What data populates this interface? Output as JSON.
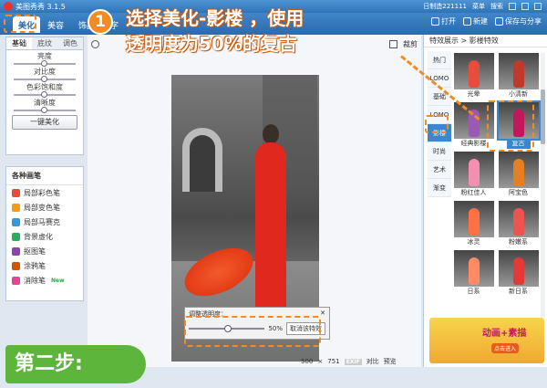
{
  "app": {
    "title": "美图秀秀 3.1.5",
    "username": "日制造221111",
    "menu_buy": "菜单",
    "menu_min": "搜索"
  },
  "menu": {
    "tabs": [
      "美化",
      "美容",
      "饰品",
      "文字"
    ]
  },
  "toolbar": {
    "open": "打开",
    "new": "新建",
    "save_share": "保存与分享"
  },
  "left": {
    "subtabs": [
      "基础",
      "底纹",
      "调色"
    ],
    "sliders": [
      {
        "label": "亮度",
        "value": 0.5
      },
      {
        "label": "对比度",
        "value": 0.5
      },
      {
        "label": "色彩饱和度",
        "value": 0.5
      },
      {
        "label": "清晰度",
        "value": 0.5
      }
    ],
    "onekey": "一键美化"
  },
  "brushes": {
    "title": "各种画笔",
    "items": [
      {
        "label": "局部彩色笔",
        "color": "#e74c3c"
      },
      {
        "label": "局部变色笔",
        "color": "#f39c12"
      },
      {
        "label": "局部马赛克",
        "color": "#3498db"
      },
      {
        "label": "背景虚化",
        "color": "#27ae60"
      },
      {
        "label": "抠图笔",
        "color": "#8e44ad"
      },
      {
        "label": "涂鸦笔",
        "color": "#d35400"
      },
      {
        "label": "消除笔",
        "color": "#e84393",
        "badge": "New"
      }
    ]
  },
  "canvas": {
    "crop": "裁剪",
    "popup": {
      "title": "调整透明度：",
      "percent": "50%",
      "value": 0.47,
      "cancel": "取消该特效"
    },
    "size_w": "500",
    "size_h": "751",
    "exif": "EXIF",
    "compare": "对比",
    "preview": "预览"
  },
  "right": {
    "breadcrumb": "特效展示 > 影楼特效",
    "categories": [
      "热门",
      "LOMO",
      "基础",
      "LOMO",
      "影楼",
      "时尚",
      "艺术",
      "渐变"
    ],
    "effects": [
      {
        "label": "光晕",
        "dress": "#e74c3c"
      },
      {
        "label": "小清新",
        "dress": "#c0392b"
      },
      {
        "label": "经典影楼",
        "dress": "#9b59b6"
      },
      {
        "label": "复古",
        "dress": "#c2185b",
        "selected": true
      },
      {
        "label": "粉红佳人",
        "dress": "#f48fb1"
      },
      {
        "label": "阿宝色",
        "dress": "#e67e22"
      },
      {
        "label": "冰灵",
        "dress": "#ff7043"
      },
      {
        "label": "粉嫩系",
        "dress": "#ef5350"
      },
      {
        "label": "日系",
        "dress": "#ff8a65"
      },
      {
        "label": "新日系",
        "dress": "#e53935"
      }
    ],
    "ad_text": "动画+素描",
    "ad_sub": "点击进入"
  },
  "annotation": {
    "step_number": "1",
    "line1": "选择美化-影楼 ，使用",
    "line2": "透明度为50%的复古",
    "step_label": "第二步:",
    "accent": "#f28b22"
  }
}
